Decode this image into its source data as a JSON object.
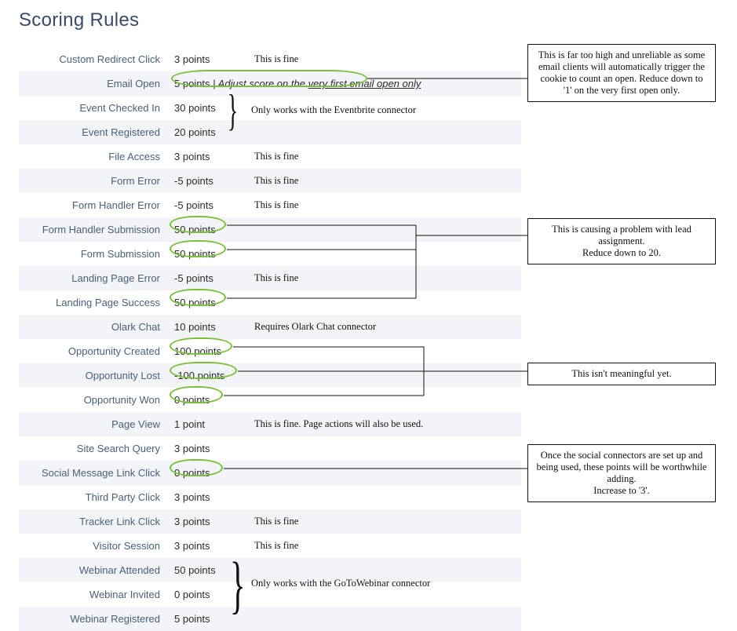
{
  "title": "Scoring Rules",
  "rows": [
    {
      "label": "Custom Redirect Click",
      "value": "3 points",
      "note": "This is fine"
    },
    {
      "label": "Email Open",
      "value": "5 points",
      "detail_prefix": " | ",
      "detail_text": "Adjust score on the ",
      "detail_underlined": "very first email open only",
      "note": ""
    },
    {
      "label": "Event Checked In",
      "value": "30 points",
      "note": ""
    },
    {
      "label": "Event Registered",
      "value": "20 points",
      "note": ""
    },
    {
      "label": "File Access",
      "value": "3 points",
      "note": "This is fine"
    },
    {
      "label": "Form Error",
      "value": "-5 points",
      "note": "This is fine"
    },
    {
      "label": "Form Handler Error",
      "value": "-5 points",
      "note": "This is fine"
    },
    {
      "label": "Form Handler Submission",
      "value": "50 points",
      "note": ""
    },
    {
      "label": "Form Submission",
      "value": "50 points",
      "note": ""
    },
    {
      "label": "Landing Page Error",
      "value": "-5 points",
      "note": "This is fine"
    },
    {
      "label": "Landing Page Success",
      "value": "50 points",
      "note": ""
    },
    {
      "label": "Olark Chat",
      "value": "10 points",
      "note": "Requires Olark Chat connector"
    },
    {
      "label": "Opportunity Created",
      "value": "100 points",
      "note": ""
    },
    {
      "label": "Opportunity Lost",
      "value": "-100 points",
      "note": ""
    },
    {
      "label": "Opportunity Won",
      "value": "0 points",
      "note": ""
    },
    {
      "label": "Page View",
      "value": "1 point",
      "note": "This is fine. Page actions will also be used."
    },
    {
      "label": "Site Search Query",
      "value": "3 points",
      "note": ""
    },
    {
      "label": "Social Message Link Click",
      "value": "0 points",
      "note": ""
    },
    {
      "label": "Third Party Click",
      "value": "3 points",
      "note": ""
    },
    {
      "label": "Tracker Link Click",
      "value": "3 points",
      "note": "This is fine"
    },
    {
      "label": "Visitor Session",
      "value": "3 points",
      "note": "This is fine"
    },
    {
      "label": "Webinar Attended",
      "value": "50 points",
      "note": ""
    },
    {
      "label": "Webinar Invited",
      "value": "0 points",
      "note": ""
    },
    {
      "label": "Webinar Registered",
      "value": "5 points",
      "note": ""
    }
  ],
  "brace_notes": {
    "eventbrite": "Only works with the Eventbrite connector",
    "gotowebinar": "Only works with the GoToWebinar connector"
  },
  "comments": {
    "email_open": "This is far too high and unreliable as some email clients will automatically trigger the cookie to count an open. Reduce down to '1' on the very first open only.",
    "form_submission": "This is causing a problem with lead assignment.\nReduce down to 20.",
    "opportunity": "This isn't meaningful yet.",
    "social": "Once the social connectors are set up and being used, these points will be worthwhile adding.\nIncrease to '3'."
  }
}
